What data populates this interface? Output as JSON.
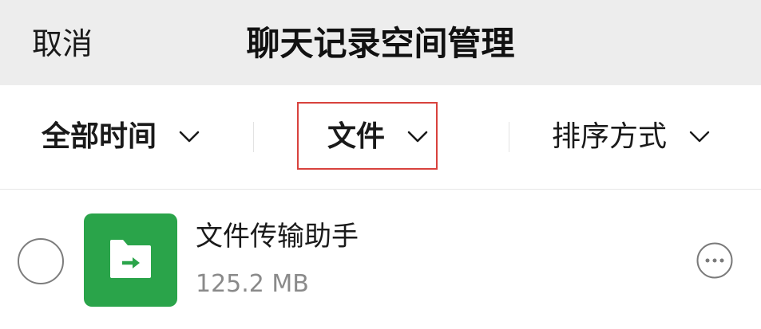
{
  "header": {
    "cancel_label": "取消",
    "title": "聊天记录空间管理"
  },
  "filters": [
    {
      "label": "全部时间",
      "icon": "chevron-down-icon"
    },
    {
      "label": "文件",
      "icon": "chevron-down-icon"
    },
    {
      "label": "排序方式",
      "icon": "chevron-down-icon"
    }
  ],
  "list": [
    {
      "name": "文件传输助手",
      "size": "125.2 MB",
      "icon": "file-transfer-folder-icon",
      "selected": false,
      "action_icon": "more-icon"
    }
  ],
  "colors": {
    "header_bg": "#ededed",
    "icon_green": "#2aa44a",
    "highlight": "#d8423d",
    "secondary_text": "#8a8a8a"
  }
}
